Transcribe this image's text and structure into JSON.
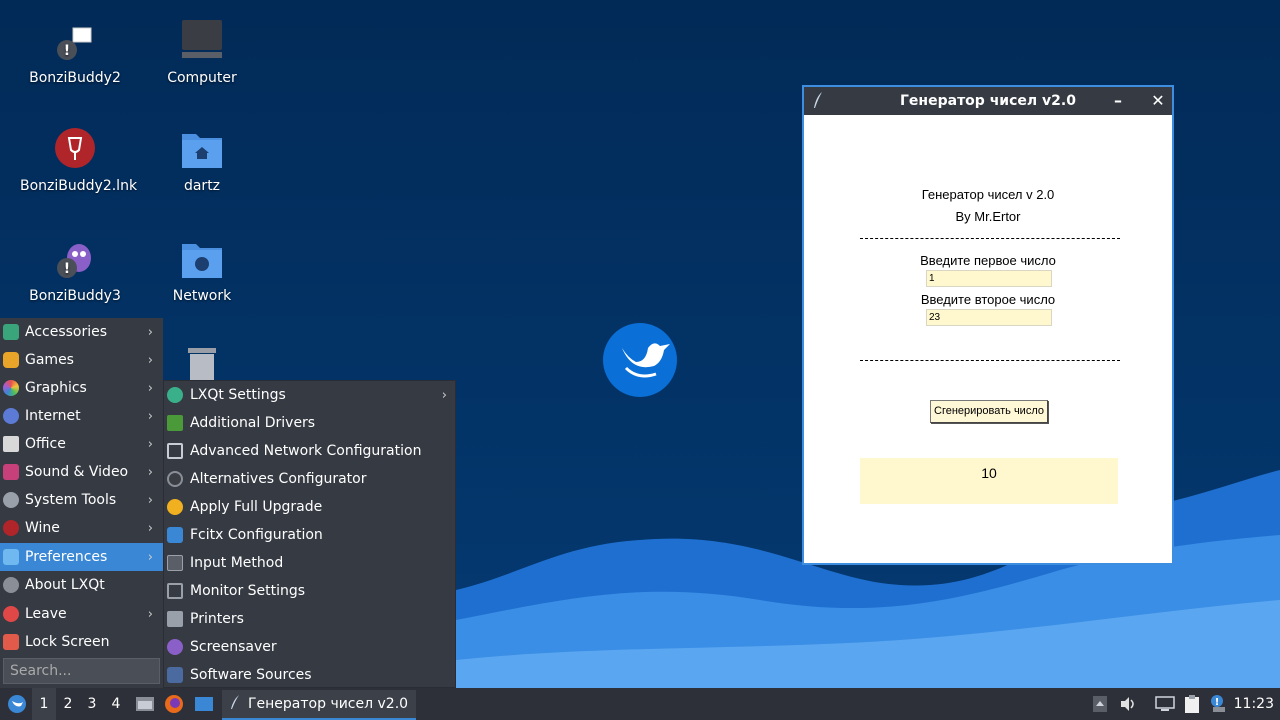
{
  "desktop": {
    "icons": [
      {
        "label": "BonziBuddy2"
      },
      {
        "label": "Computer"
      },
      {
        "label": "BonziBuddy2.lnk"
      },
      {
        "label": "dartz"
      },
      {
        "label": "BonziBuddy3"
      },
      {
        "label": "Network"
      }
    ]
  },
  "app": {
    "title": "Генератор чисел v2.0",
    "heading": "Генератор чисел v 2.0",
    "author": "By Mr.Ertor",
    "label_first": "Введите первое число",
    "value_first": "1",
    "label_second": "Введите второе число",
    "value_second": "23",
    "button_label": "Сгенерировать число",
    "result": "10"
  },
  "main_menu": {
    "items": [
      {
        "label": "Accessories",
        "icon": "accessories-icon",
        "has_submenu": true
      },
      {
        "label": "Games",
        "icon": "games-icon",
        "has_submenu": true
      },
      {
        "label": "Graphics",
        "icon": "graphics-icon",
        "has_submenu": true
      },
      {
        "label": "Internet",
        "icon": "internet-icon",
        "has_submenu": true
      },
      {
        "label": "Office",
        "icon": "office-icon",
        "has_submenu": true
      },
      {
        "label": "Sound & Video",
        "icon": "sound-video-icon",
        "has_submenu": true
      },
      {
        "label": "System Tools",
        "icon": "system-tools-icon",
        "has_submenu": true
      },
      {
        "label": "Wine",
        "icon": "wine-icon",
        "has_submenu": true
      },
      {
        "label": "Preferences",
        "icon": "preferences-icon",
        "has_submenu": true
      },
      {
        "label": "About LXQt",
        "icon": "info-icon",
        "has_submenu": false
      },
      {
        "label": "Leave",
        "icon": "power-icon",
        "has_submenu": true
      },
      {
        "label": "Lock Screen",
        "icon": "lock-icon",
        "has_submenu": false
      }
    ],
    "search_placeholder": "Search..."
  },
  "sub_menu": {
    "items": [
      {
        "label": "LXQt Settings",
        "icon": "lxqt-settings-icon",
        "has_submenu": true
      },
      {
        "label": "Additional Drivers",
        "icon": "chip-icon",
        "has_submenu": false
      },
      {
        "label": "Advanced Network Configuration",
        "icon": "network-config-icon",
        "has_submenu": false
      },
      {
        "label": "Alternatives Configurator",
        "icon": "alternatives-icon",
        "has_submenu": false
      },
      {
        "label": "Apply Full Upgrade",
        "icon": "upgrade-icon",
        "has_submenu": false
      },
      {
        "label": "Fcitx Configuration",
        "icon": "fcitx-icon",
        "has_submenu": false
      },
      {
        "label": "Input Method",
        "icon": "keyboard-icon",
        "has_submenu": false
      },
      {
        "label": "Monitor Settings",
        "icon": "monitor-icon",
        "has_submenu": false
      },
      {
        "label": "Printers",
        "icon": "printer-icon",
        "has_submenu": false
      },
      {
        "label": "Screensaver",
        "icon": "screensaver-icon",
        "has_submenu": false
      },
      {
        "label": "Software Sources",
        "icon": "software-sources-icon",
        "has_submenu": false
      }
    ]
  },
  "taskbar": {
    "desktops": [
      "1",
      "2",
      "3",
      "4"
    ],
    "task_title": "Генератор чисел v2.0",
    "clock": "11:23"
  },
  "colors": {
    "accent": "#3a87d6",
    "panel": "#363a43",
    "input_bg": "#fff8cf"
  }
}
